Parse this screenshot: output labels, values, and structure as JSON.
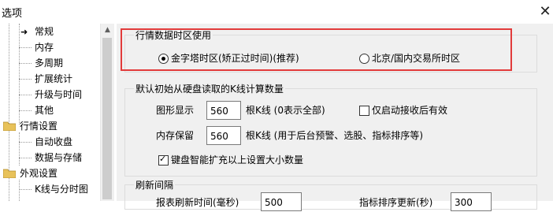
{
  "window": {
    "title": "选项",
    "close_glyph": "✕"
  },
  "tree": {
    "items": [
      {
        "label": "常规",
        "selected": true
      },
      {
        "label": "内存"
      },
      {
        "label": "多周期"
      },
      {
        "label": "扩展统计"
      },
      {
        "label": "升级与时间"
      },
      {
        "label": "其他"
      },
      {
        "label": "行情设置",
        "folder": true
      },
      {
        "label": "自动收盘"
      },
      {
        "label": "数据与存储"
      },
      {
        "label": "外观设置",
        "folder": true
      },
      {
        "label": "K线与分时图"
      }
    ]
  },
  "timezone": {
    "group_label": "行情数据时区使用",
    "option_golden": "金字塔时区(矫正过时间)(推荐)",
    "option_beijing": "北京/国内交易所时区",
    "selected": "golden"
  },
  "kline_count": {
    "group_label": "默认初始从硬盘读取的K线计算数量",
    "display_label": "图形显示",
    "display_value": "560",
    "display_unit": "根K线 (0表示全部)",
    "startup_only_label": "仅启动接收后有效",
    "startup_only_checked": false,
    "memory_label": "内存保留",
    "memory_value": "560",
    "memory_unit": "根K线 (用于后台预警、选股、指标排序等)",
    "smart_expand_label": "键盘智能扩充以上设置大小数量",
    "smart_expand_checked": true
  },
  "refresh": {
    "group_label": "刷新间隔",
    "report_label": "报表刷新时间(毫秒)",
    "report_value": "500",
    "indicator_label": "指标排序更新(秒)",
    "indicator_value": "300"
  },
  "colors": {
    "highlight": "#e23b3b",
    "panel_bg": "#f0f0f0"
  }
}
